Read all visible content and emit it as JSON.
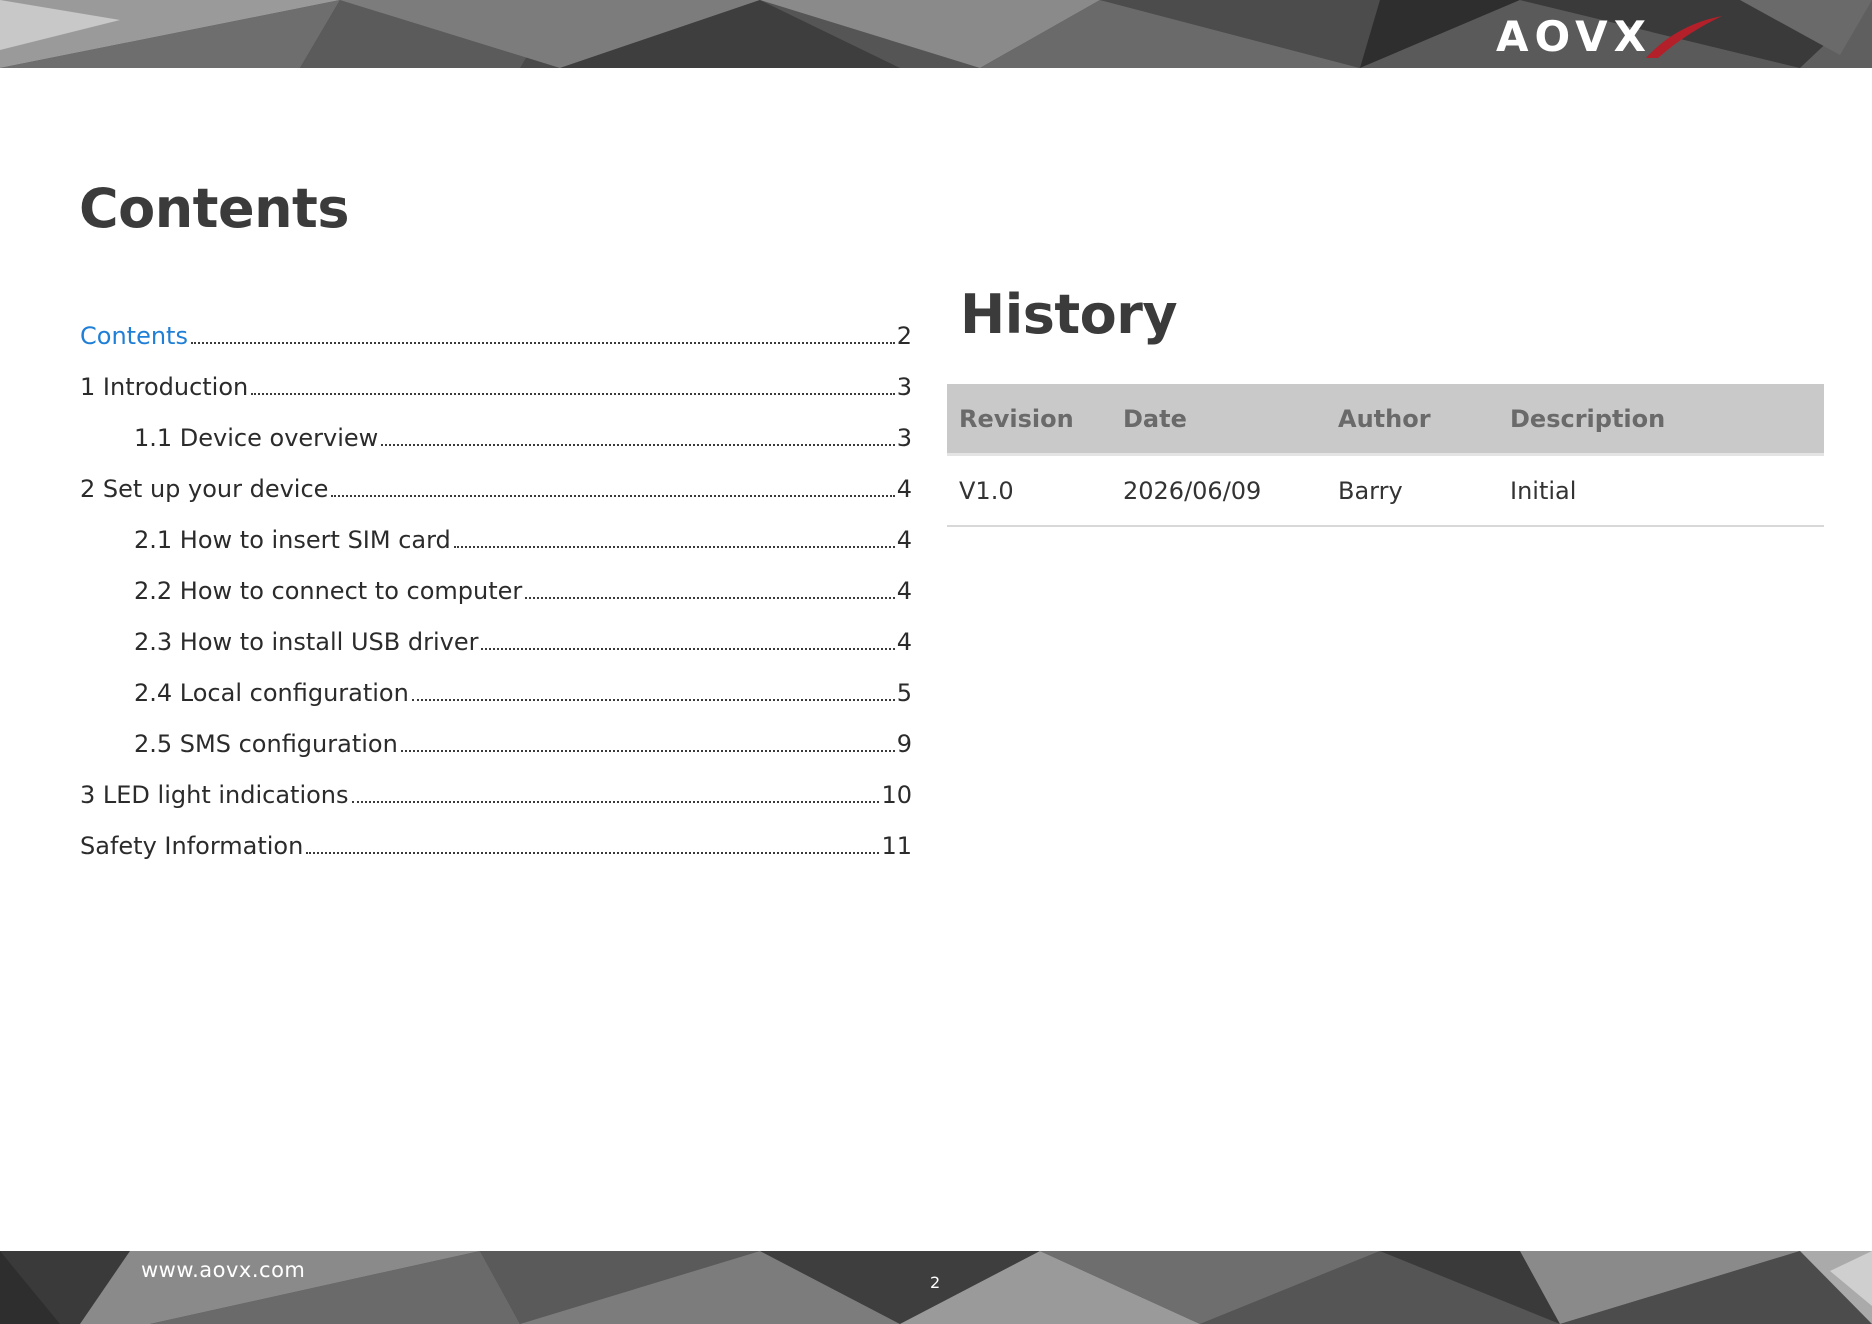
{
  "header": {
    "logo_text": "AOVX"
  },
  "contents": {
    "title": "Contents",
    "entries": [
      {
        "label": "Contents",
        "page": "2",
        "level": 1,
        "link": true
      },
      {
        "label": "1 Introduction",
        "page": "3",
        "level": 1,
        "link": false
      },
      {
        "label": "1.1 Device overview",
        "page": "3",
        "level": 2,
        "link": false
      },
      {
        "label": "2 Set up your device",
        "page": "4",
        "level": 1,
        "link": false
      },
      {
        "label": "2.1 How to insert SIM card",
        "page": "4",
        "level": 2,
        "link": false
      },
      {
        "label": "2.2 How to connect to computer",
        "page": "4",
        "level": 2,
        "link": false
      },
      {
        "label": "2.3 How to install USB driver",
        "page": "4",
        "level": 2,
        "link": false
      },
      {
        "label": "2.4 Local configuration",
        "page": "5",
        "level": 2,
        "link": false
      },
      {
        "label": "2.5 SMS configuration",
        "page": "9",
        "level": 2,
        "link": false
      },
      {
        "label": "3 LED light indications",
        "page": "10",
        "level": 1,
        "link": false
      },
      {
        "label": "Safety Information",
        "page": "11",
        "level": 1,
        "link": false
      }
    ]
  },
  "history": {
    "title": "History",
    "headers": [
      "Revision",
      "Date",
      "Author",
      "Description"
    ],
    "rows": [
      [
        "V1.0",
        "2026/06/09",
        "Barry",
        "Initial"
      ]
    ]
  },
  "footer": {
    "url": "www.aovx.com",
    "page_number": "2"
  },
  "colors": {
    "link": "#1f7fd6",
    "heading": "#3b3b3b",
    "table_header_bg": "#c9c9c9",
    "banner_dark": "#3a3a3a",
    "banner_light": "#8a8a8a"
  }
}
